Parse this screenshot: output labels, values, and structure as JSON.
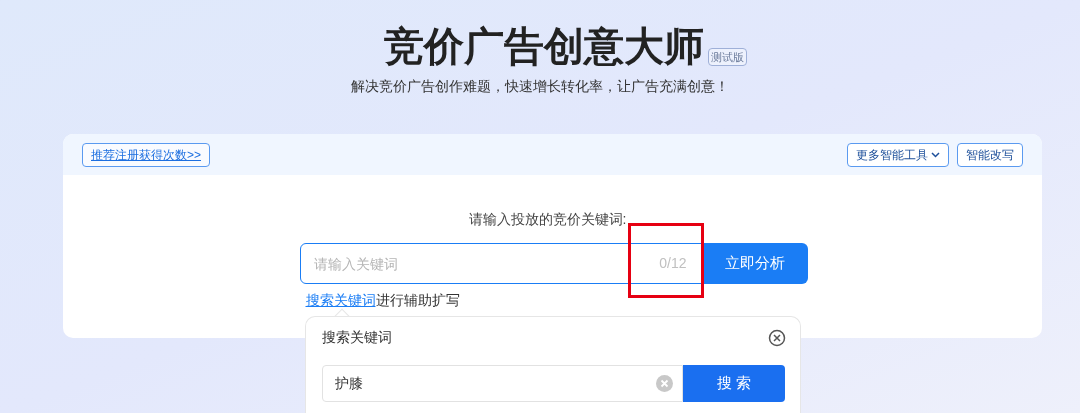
{
  "header": {
    "title": "竞价广告创意大师",
    "badge": "测试版",
    "subtitle": "解决竞价广告创作难题，快速增长转化率，让广告充满创意！"
  },
  "toolbar": {
    "promo_link": "推荐注册获得次数>>",
    "buttons": [
      {
        "label": "更多智能工具",
        "kind": "dropdown"
      },
      {
        "label": "智能改写",
        "kind": "plain"
      }
    ]
  },
  "keyword_form": {
    "prompt": "请输入投放的竞价关键词:",
    "placeholder": "请输入关键词",
    "counter": "0/12",
    "submit": "立即分析",
    "help_link": "搜索关键词",
    "help_text": "进行辅助扩写",
    "highlight_counter": true
  },
  "search_popover": {
    "title": "搜索关键词",
    "value": "护膝",
    "button": "搜 索"
  }
}
